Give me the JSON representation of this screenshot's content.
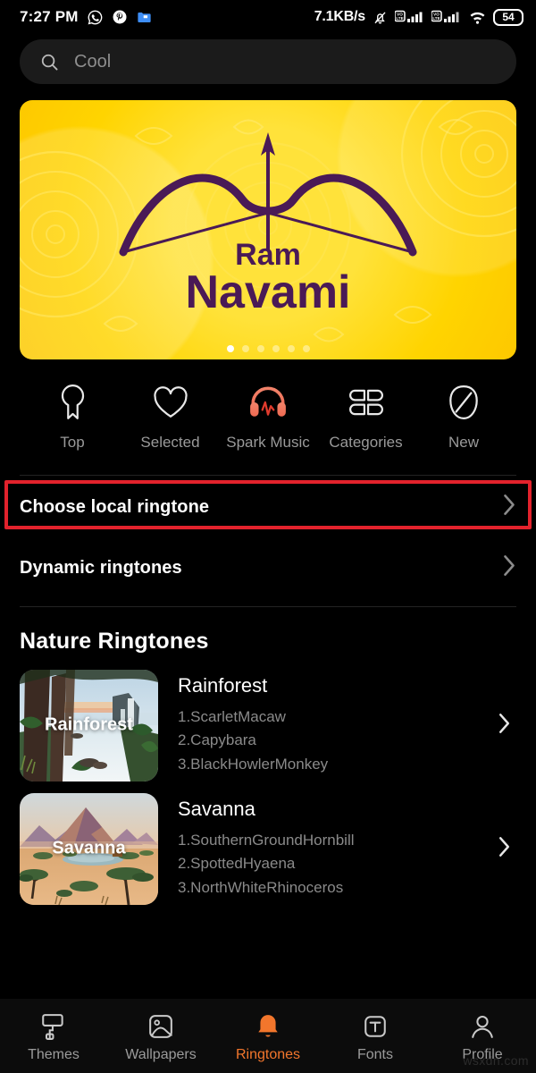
{
  "status_bar": {
    "time": "7:27 PM",
    "left_icons": [
      "whatsapp-icon",
      "pinterest-icon",
      "file-manager-icon"
    ],
    "network_speed": "7.1KB/s",
    "right_icons": [
      "bell-mute-icon",
      "volte-signal-icon",
      "volte-signal-icon",
      "wifi-icon"
    ],
    "battery_level": "54"
  },
  "search": {
    "placeholder": "Cool",
    "icon": "search-icon"
  },
  "banner": {
    "title_small": "Ram",
    "title_large": "Navami",
    "background_color": "#ffd400",
    "accent_color": "#4a1a56",
    "dot_count": 6,
    "active_dot": 1
  },
  "quick_links": [
    {
      "label": "Top",
      "icon": "ribbon-badge-icon",
      "active": false
    },
    {
      "label": "Selected",
      "icon": "heart-icon",
      "active": false
    },
    {
      "label": "Spark Music",
      "icon": "headphones-waveform-icon",
      "active": true
    },
    {
      "label": "Categories",
      "icon": "four-petal-grid-icon",
      "active": false
    },
    {
      "label": "New",
      "icon": "leaf-icon",
      "active": false
    }
  ],
  "rows": [
    {
      "label": "Choose local ringtone",
      "icon": "chevron-right-icon",
      "highlighted": true
    },
    {
      "label": "Dynamic ringtones",
      "icon": "chevron-right-icon",
      "highlighted": false
    }
  ],
  "highlight_color": "#e2222c",
  "section": {
    "title": "Nature Ringtones",
    "cards": [
      {
        "title": "Rainforest",
        "thumb_label": "Rainforest",
        "thumb_icon": "rainforest-thumbnail",
        "tracks": [
          "1.ScarletMacaw",
          "2.Capybara",
          "3.BlackHowlerMonkey"
        ],
        "chevron": "chevron-right-icon"
      },
      {
        "title": "Savanna",
        "thumb_label": "Savanna",
        "thumb_icon": "savanna-thumbnail",
        "tracks": [
          "1.SouthernGroundHornbill",
          "2.SpottedHyaena",
          "3.NorthWhiteRhinoceros"
        ],
        "chevron": "chevron-right-icon"
      }
    ]
  },
  "bottom_nav": {
    "active_color": "#f2762c",
    "items": [
      {
        "label": "Themes",
        "icon": "paint-roller-icon",
        "active": false
      },
      {
        "label": "Wallpapers",
        "icon": "image-icon",
        "active": false
      },
      {
        "label": "Ringtones",
        "icon": "bell-icon",
        "active": true
      },
      {
        "label": "Fonts",
        "icon": "font-t-icon",
        "active": false
      },
      {
        "label": "Profile",
        "icon": "person-icon",
        "active": false
      }
    ]
  },
  "watermark": "wsxdn.com"
}
